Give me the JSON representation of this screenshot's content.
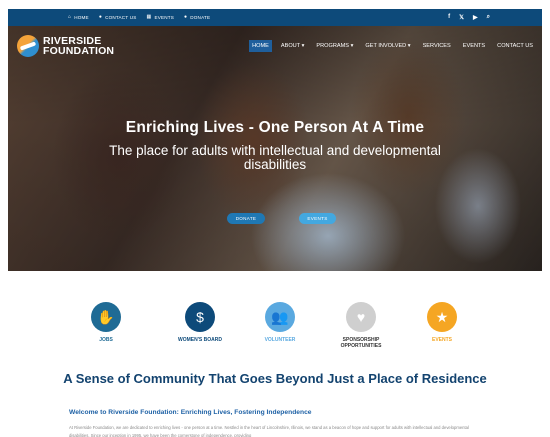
{
  "topbar": {
    "links": [
      {
        "label": "HOME",
        "icon": "home-icon",
        "glyph": "⌂"
      },
      {
        "label": "CONTACT US",
        "icon": "user-icon",
        "glyph": "●"
      },
      {
        "label": "EVENTS",
        "icon": "calendar-icon",
        "glyph": "▦"
      },
      {
        "label": "DONATE",
        "icon": "user-icon",
        "glyph": "●"
      }
    ],
    "social": [
      {
        "icon": "facebook-icon",
        "glyph": "f"
      },
      {
        "icon": "twitter-icon",
        "glyph": "𝕏"
      },
      {
        "icon": "youtube-icon",
        "glyph": "▶"
      },
      {
        "icon": "search-icon",
        "glyph": "⌕"
      }
    ]
  },
  "logo": {
    "line1": "RIVERSIDE",
    "line2": "FOUNDATION"
  },
  "nav": [
    {
      "label": "HOME",
      "active": true
    },
    {
      "label": "ABOUT ▾"
    },
    {
      "label": "PROGRAMS ▾"
    },
    {
      "label": "GET INVOLVED ▾"
    },
    {
      "label": "SERVICES"
    },
    {
      "label": "EVENTS"
    },
    {
      "label": "CONTACT US"
    }
  ],
  "hero": {
    "title": "Enriching Lives - One Person At A Time",
    "subtitle": "The place for adults with intellectual and developmental disabilities",
    "donate_label": "DONATE",
    "events_label": "EVENTS"
  },
  "features": [
    {
      "label": "JOBS",
      "color": "#1f6b95",
      "icon": "hands-icon",
      "glyph": "✋",
      "label_color": "#1f6b95"
    },
    {
      "label": "WOMEN'S BOARD",
      "color": "#0d4a7a",
      "icon": "donation-hand-icon",
      "glyph": "$",
      "label_color": "#0d4a7a"
    },
    {
      "label": "VOLUNTEER",
      "color": "#5aa9e0",
      "icon": "people-icon",
      "glyph": "👥",
      "label_color": "#5aa9e0"
    },
    {
      "label": "SPONSORSHIP OPPORTUNITIES",
      "color": "#cfcfcf",
      "icon": "heart-icon",
      "glyph": "♥",
      "label_color": "#333333"
    },
    {
      "label": "EVENTS",
      "color": "#f5a623",
      "icon": "star-icon",
      "glyph": "★",
      "label_color": "#f5a623"
    }
  ],
  "section": {
    "title": "A Sense of Community That Goes Beyond Just a Place of Residence",
    "subtitle": "Welcome to Riverside Foundation: Enriching Lives, Fostering Independence",
    "body": "At Riverside Foundation, we are dedicated to enriching lives - one person at a time. Nestled in the heart of Lincolnshire, Illinois, we stand as a beacon of hope and support for adults with intellectual and developmental disabilities. Since our inception in 1995, we have been the cornerstone of independence, providing"
  }
}
